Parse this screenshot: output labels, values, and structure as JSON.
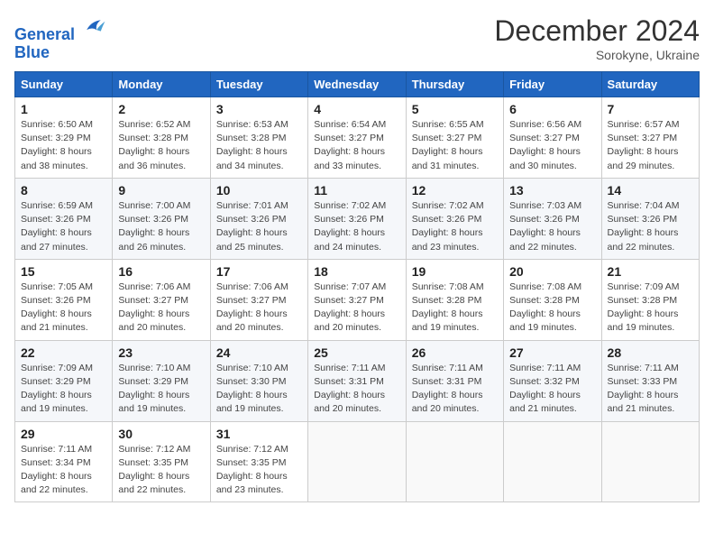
{
  "header": {
    "logo_line1": "General",
    "logo_line2": "Blue",
    "month": "December 2024",
    "location": "Sorokyne, Ukraine"
  },
  "days_of_week": [
    "Sunday",
    "Monday",
    "Tuesday",
    "Wednesday",
    "Thursday",
    "Friday",
    "Saturday"
  ],
  "weeks": [
    [
      {
        "day": "1",
        "sunrise": "6:50 AM",
        "sunset": "3:29 PM",
        "daylight": "8 hours and 38 minutes."
      },
      {
        "day": "2",
        "sunrise": "6:52 AM",
        "sunset": "3:28 PM",
        "daylight": "8 hours and 36 minutes."
      },
      {
        "day": "3",
        "sunrise": "6:53 AM",
        "sunset": "3:28 PM",
        "daylight": "8 hours and 34 minutes."
      },
      {
        "day": "4",
        "sunrise": "6:54 AM",
        "sunset": "3:27 PM",
        "daylight": "8 hours and 33 minutes."
      },
      {
        "day": "5",
        "sunrise": "6:55 AM",
        "sunset": "3:27 PM",
        "daylight": "8 hours and 31 minutes."
      },
      {
        "day": "6",
        "sunrise": "6:56 AM",
        "sunset": "3:27 PM",
        "daylight": "8 hours and 30 minutes."
      },
      {
        "day": "7",
        "sunrise": "6:57 AM",
        "sunset": "3:27 PM",
        "daylight": "8 hours and 29 minutes."
      }
    ],
    [
      {
        "day": "8",
        "sunrise": "6:59 AM",
        "sunset": "3:26 PM",
        "daylight": "8 hours and 27 minutes."
      },
      {
        "day": "9",
        "sunrise": "7:00 AM",
        "sunset": "3:26 PM",
        "daylight": "8 hours and 26 minutes."
      },
      {
        "day": "10",
        "sunrise": "7:01 AM",
        "sunset": "3:26 PM",
        "daylight": "8 hours and 25 minutes."
      },
      {
        "day": "11",
        "sunrise": "7:02 AM",
        "sunset": "3:26 PM",
        "daylight": "8 hours and 24 minutes."
      },
      {
        "day": "12",
        "sunrise": "7:02 AM",
        "sunset": "3:26 PM",
        "daylight": "8 hours and 23 minutes."
      },
      {
        "day": "13",
        "sunrise": "7:03 AM",
        "sunset": "3:26 PM",
        "daylight": "8 hours and 22 minutes."
      },
      {
        "day": "14",
        "sunrise": "7:04 AM",
        "sunset": "3:26 PM",
        "daylight": "8 hours and 22 minutes."
      }
    ],
    [
      {
        "day": "15",
        "sunrise": "7:05 AM",
        "sunset": "3:26 PM",
        "daylight": "8 hours and 21 minutes."
      },
      {
        "day": "16",
        "sunrise": "7:06 AM",
        "sunset": "3:27 PM",
        "daylight": "8 hours and 20 minutes."
      },
      {
        "day": "17",
        "sunrise": "7:06 AM",
        "sunset": "3:27 PM",
        "daylight": "8 hours and 20 minutes."
      },
      {
        "day": "18",
        "sunrise": "7:07 AM",
        "sunset": "3:27 PM",
        "daylight": "8 hours and 20 minutes."
      },
      {
        "day": "19",
        "sunrise": "7:08 AM",
        "sunset": "3:28 PM",
        "daylight": "8 hours and 19 minutes."
      },
      {
        "day": "20",
        "sunrise": "7:08 AM",
        "sunset": "3:28 PM",
        "daylight": "8 hours and 19 minutes."
      },
      {
        "day": "21",
        "sunrise": "7:09 AM",
        "sunset": "3:28 PM",
        "daylight": "8 hours and 19 minutes."
      }
    ],
    [
      {
        "day": "22",
        "sunrise": "7:09 AM",
        "sunset": "3:29 PM",
        "daylight": "8 hours and 19 minutes."
      },
      {
        "day": "23",
        "sunrise": "7:10 AM",
        "sunset": "3:29 PM",
        "daylight": "8 hours and 19 minutes."
      },
      {
        "day": "24",
        "sunrise": "7:10 AM",
        "sunset": "3:30 PM",
        "daylight": "8 hours and 19 minutes."
      },
      {
        "day": "25",
        "sunrise": "7:11 AM",
        "sunset": "3:31 PM",
        "daylight": "8 hours and 20 minutes."
      },
      {
        "day": "26",
        "sunrise": "7:11 AM",
        "sunset": "3:31 PM",
        "daylight": "8 hours and 20 minutes."
      },
      {
        "day": "27",
        "sunrise": "7:11 AM",
        "sunset": "3:32 PM",
        "daylight": "8 hours and 21 minutes."
      },
      {
        "day": "28",
        "sunrise": "7:11 AM",
        "sunset": "3:33 PM",
        "daylight": "8 hours and 21 minutes."
      }
    ],
    [
      {
        "day": "29",
        "sunrise": "7:11 AM",
        "sunset": "3:34 PM",
        "daylight": "8 hours and 22 minutes."
      },
      {
        "day": "30",
        "sunrise": "7:12 AM",
        "sunset": "3:35 PM",
        "daylight": "8 hours and 22 minutes."
      },
      {
        "day": "31",
        "sunrise": "7:12 AM",
        "sunset": "3:35 PM",
        "daylight": "8 hours and 23 minutes."
      },
      null,
      null,
      null,
      null
    ]
  ],
  "labels": {
    "sunrise_prefix": "Sunrise: ",
    "sunset_prefix": "Sunset: ",
    "daylight_prefix": "Daylight: "
  }
}
